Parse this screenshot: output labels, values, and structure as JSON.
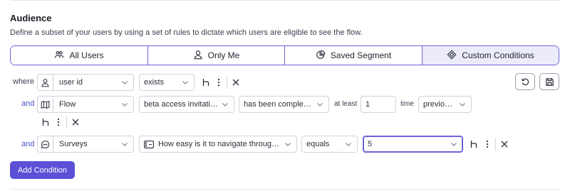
{
  "audience": {
    "title": "Audience",
    "description": "Define a subset of your users by using a set of rules to dictate which users are eligible to see the flow."
  },
  "tabs": [
    {
      "label": "All Users",
      "icon": "users-icon",
      "active": false
    },
    {
      "label": "Only Me",
      "icon": "person-icon",
      "active": false
    },
    {
      "label": "Saved Segment",
      "icon": "pie-chart-icon",
      "active": false
    },
    {
      "label": "Custom Conditions",
      "icon": "diamond-icon",
      "active": true
    }
  ],
  "conditions": [
    {
      "connector": "where",
      "property": {
        "icon": "person-icon",
        "value": "user id"
      },
      "operator": "exists"
    },
    {
      "connector": "and",
      "property": {
        "icon": "map-icon",
        "value": "Flow"
      },
      "flow": "beta access invitation",
      "state": "has been completed",
      "at_least_label": "at least",
      "count": "1",
      "time_label": "time",
      "timeframe": "previously"
    },
    {
      "connector": "and",
      "property": {
        "icon": "chat-bubble-icon",
        "value": "Surveys"
      },
      "question": "How easy is it to navigate through U...",
      "operator": "equals",
      "value": "5"
    }
  ],
  "actions": {
    "add_condition": "Add Condition"
  },
  "colors": {
    "accent": "#5b50d6",
    "accent_border": "#6c63d9",
    "active_tab_bg": "#ecebfa",
    "connector_and": "#4a51c9"
  }
}
